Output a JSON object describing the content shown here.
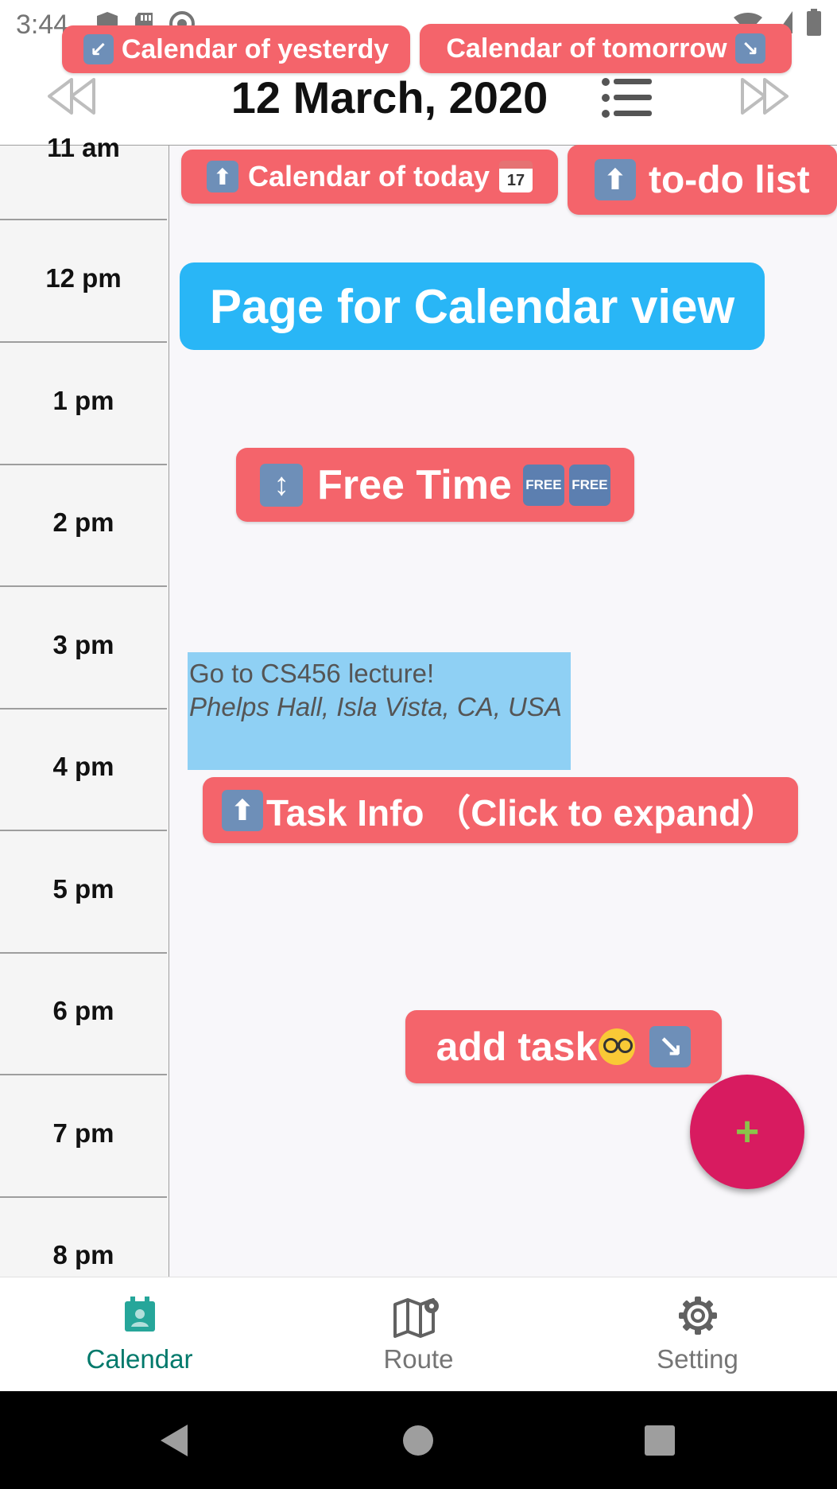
{
  "status_bar": {
    "time": "3:44"
  },
  "header": {
    "date_title": "12 March, 2020",
    "prev_label": "Calendar of yesterdy",
    "next_label": "Calendar of tomorrow"
  },
  "timeline": {
    "hours": [
      "11 am",
      "12 pm",
      "1 pm",
      "2 pm",
      "3 pm",
      "4 pm",
      "5 pm",
      "6 pm",
      "7 pm",
      "8 pm"
    ]
  },
  "annotations": {
    "today": "Calendar of today",
    "todo": "to-do list",
    "page_title": "Page for Calendar view",
    "free_time": "Free Time",
    "free_badge": "FREE",
    "task_info": "Task Info （Click to expand）",
    "add_task": "add task"
  },
  "event": {
    "title": "Go to CS456 lecture!",
    "location": "Phelps Hall, Isla Vista, CA, USA"
  },
  "fab": {
    "symbol": "+"
  },
  "bottom_nav": {
    "items": [
      {
        "label": "Calendar",
        "active": true
      },
      {
        "label": "Route",
        "active": false
      },
      {
        "label": "Setting",
        "active": false
      }
    ]
  },
  "colors": {
    "accent": "#00796b",
    "pill": "#f4646b",
    "fab": "#d81b60",
    "event": "#8fd0f4",
    "blue_banner": "#29b6f6"
  }
}
